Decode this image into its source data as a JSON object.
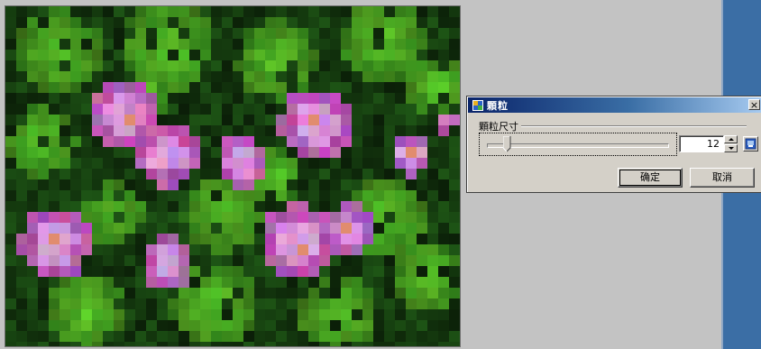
{
  "dialog": {
    "title": "顆粒",
    "group_label": "顆粒尺寸",
    "grain_size_value": "12",
    "slider": {
      "min": 1,
      "max": 100,
      "value": 12
    },
    "ok_label": "确定",
    "cancel_label": "取消",
    "close_glyph": "×"
  },
  "icons": {
    "title_icon": "app-icon",
    "close": "close-icon",
    "spin_up": "spin-up-icon",
    "spin_down": "spin-down-icon",
    "preview": "preview-icon"
  },
  "colors": {
    "titlebar_start": "#0a246a",
    "titlebar_end": "#a6caf0",
    "dialog_face": "#d4d0c8",
    "desktop": "#3b6ea5",
    "workspace": "#c3c3c3"
  }
}
